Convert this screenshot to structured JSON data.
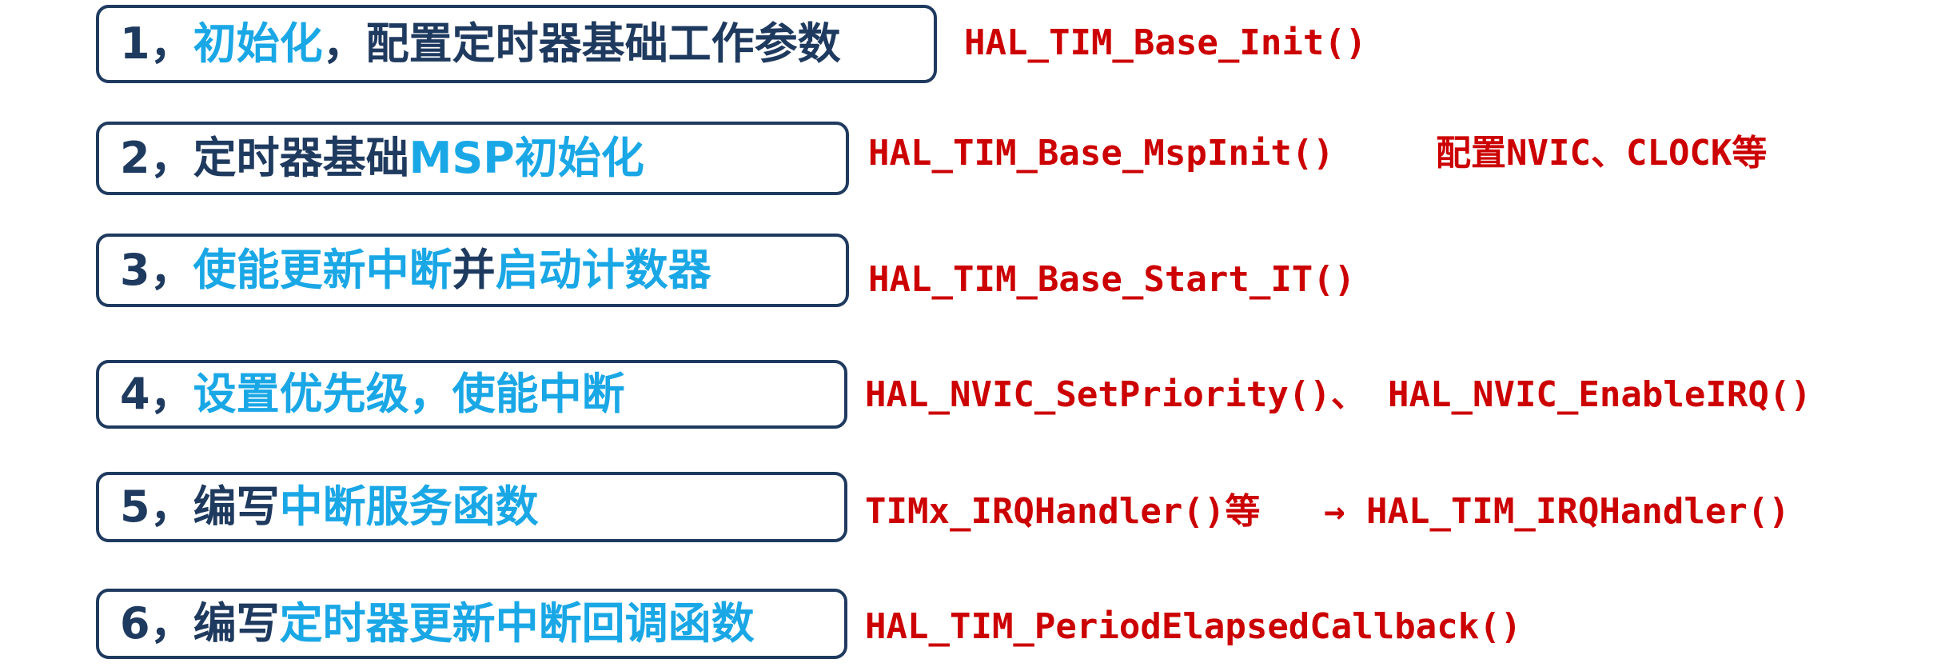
{
  "colors": {
    "box_border": "#1f3a5f",
    "text_dark": "#1f3a5f",
    "text_blue": "#1aa7e6",
    "api_red": "#cc0000"
  },
  "steps": [
    {
      "segments": [
        {
          "text": "1，",
          "color": "dark"
        },
        {
          "text": "初始化",
          "color": "blue"
        },
        {
          "text": "，配置定时器基础工作参数",
          "color": "dark"
        }
      ],
      "api": [
        "HAL_TIM_Base_Init()"
      ]
    },
    {
      "segments": [
        {
          "text": "2，定时器基础",
          "color": "dark"
        },
        {
          "text": "MSP初始化",
          "color": "blue"
        }
      ],
      "api": [
        "HAL_TIM_Base_MspInit()",
        "配置NVIC、CLOCK等"
      ]
    },
    {
      "segments": [
        {
          "text": "3，",
          "color": "dark"
        },
        {
          "text": "使能更新中断",
          "color": "blue"
        },
        {
          "text": "并",
          "color": "dark"
        },
        {
          "text": "启动计数器",
          "color": "blue"
        }
      ],
      "api": [
        "HAL_TIM_Base_Start_IT()"
      ]
    },
    {
      "segments": [
        {
          "text": "4，",
          "color": "dark"
        },
        {
          "text": "设置优先级，使能中断",
          "color": "blue"
        }
      ],
      "api": [
        "HAL_NVIC_SetPriority()、",
        "HAL_NVIC_EnableIRQ()"
      ]
    },
    {
      "segments": [
        {
          "text": "5，编写",
          "color": "dark"
        },
        {
          "text": "中断服务函数",
          "color": "blue"
        }
      ],
      "api": [
        "TIMx_IRQHandler()等",
        "→ HAL_TIM_IRQHandler()"
      ]
    },
    {
      "segments": [
        {
          "text": "6，编写",
          "color": "dark"
        },
        {
          "text": "定时器更新中断回调函数",
          "color": "blue"
        }
      ],
      "api": [
        "HAL_TIM_PeriodElapsedCallback()"
      ]
    }
  ]
}
